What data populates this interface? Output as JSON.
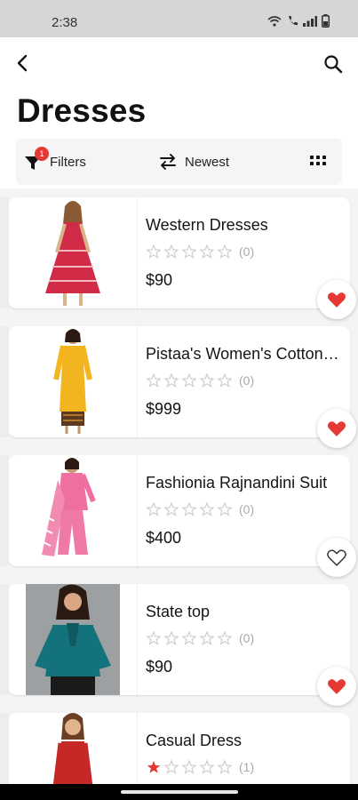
{
  "status_bar": {
    "time": "2:38",
    "icons": [
      "wifi-calling-icon",
      "phone-wifi-icon",
      "signal-icon",
      "battery-icon"
    ]
  },
  "header": {
    "back_icon": "back-arrow-icon",
    "search_icon": "search-icon"
  },
  "page": {
    "title": "Dresses"
  },
  "toolbar": {
    "filters_label": "Filters",
    "filters_badge": "1",
    "sort_label": "Newest",
    "view_icon": "grid-view-icon"
  },
  "products": [
    {
      "name": "Western Dresses",
      "rating": 0,
      "reviews": "(0)",
      "price": "$90",
      "favorited": true
    },
    {
      "name": "Pistaa's Women's Cotton Kurta",
      "rating": 0,
      "reviews": "(0)",
      "price": "$999",
      "favorited": true
    },
    {
      "name": "Fashionia Rajnandini Suit",
      "rating": 0,
      "reviews": "(0)",
      "price": "$400",
      "favorited": false
    },
    {
      "name": "State top",
      "rating": 0,
      "reviews": "(0)",
      "price": "$90",
      "favorited": true
    },
    {
      "name": "Casual Dress",
      "rating": 1,
      "reviews": "(1)",
      "price": "",
      "favorited": false
    }
  ],
  "colors": {
    "accent": "#e53935",
    "star_empty": "#cfcfcf",
    "star_filled": "#e53935"
  }
}
